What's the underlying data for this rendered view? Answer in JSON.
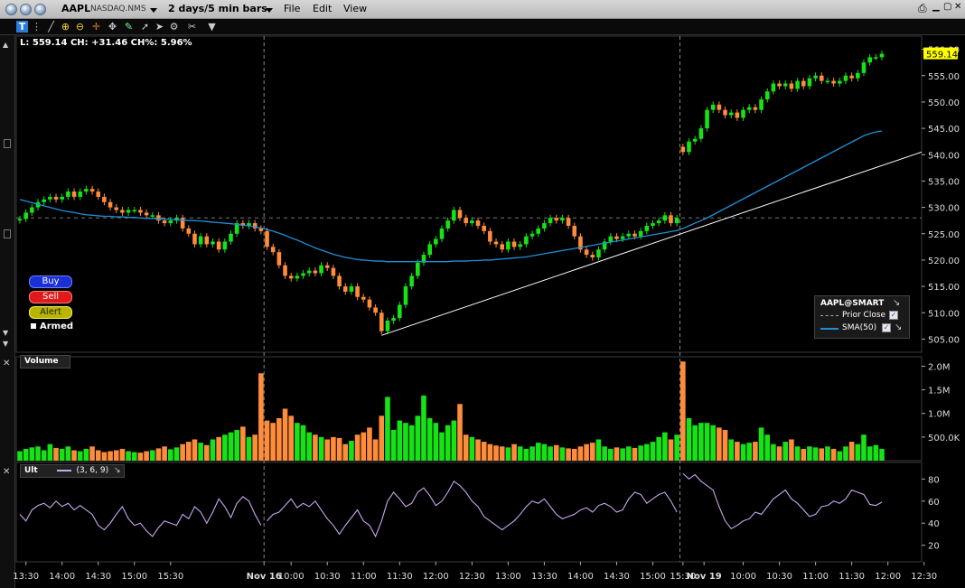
{
  "window": {
    "symbol": "AAPL",
    "exchange": "NASDAQ.NMS",
    "period": "2 days/5 min bars",
    "menus": [
      "File",
      "Edit",
      "View"
    ]
  },
  "quote": {
    "label": "L:",
    "last": "559.14",
    "change_label": "CH:",
    "change": "+31.46",
    "change_pct_label": "CH%:",
    "change_pct": "5.96%"
  },
  "order_buttons": {
    "buy": "Buy",
    "sell": "Sell",
    "alert": "Alert",
    "armed": "Armed"
  },
  "legend": {
    "title": "AAPL@SMART",
    "items": [
      {
        "label": "Prior Close",
        "color": "#aaaaaa",
        "style": "dashed"
      },
      {
        "label": "SMA(50)",
        "color": "#1e8fd6",
        "style": "solid"
      }
    ]
  },
  "volume_panel": {
    "title": "Volume"
  },
  "ult_panel": {
    "title": "Ult",
    "params": "(3, 6, 9)",
    "color": "#c9a8f0"
  },
  "colors": {
    "up": "#16e316",
    "down": "#ff8c3a",
    "sma": "#1e8fd6",
    "trendline": "#ffffff",
    "background": "#000000",
    "price_highlight": "#ffff00"
  },
  "chart_data": [
    {
      "type": "candlestick",
      "title": "AAPL",
      "last_price": 559.14,
      "prior_close": 528.0,
      "ylim": [
        502.5,
        562.5
      ],
      "y_ticks": [
        "505.00",
        "510.00",
        "515.00",
        "520.00",
        "525.00",
        "530.00",
        "535.00",
        "540.00",
        "545.00",
        "550.00",
        "555.00",
        "560.00"
      ],
      "x_ticks": [
        "13:30",
        "14:00",
        "14:30",
        "15:00",
        "15:30",
        "Nov 16",
        "10:00",
        "10:30",
        "11:00",
        "11:30",
        "12:00",
        "12:30",
        "13:00",
        "13:30",
        "14:00",
        "14:30",
        "15:00",
        "15:30",
        "Nov 19",
        "10:00",
        "10:30",
        "11:00",
        "11:30",
        "12:00",
        "12:30"
      ],
      "session_breaks": [
        "Nov 16",
        "Nov 19"
      ],
      "closes": [
        527.8,
        529.0,
        530.0,
        531.0,
        531.5,
        532.0,
        531.5,
        532.0,
        533.0,
        532.0,
        533.0,
        533.5,
        533.0,
        532.0,
        531.0,
        530.0,
        529.5,
        529.0,
        529.5,
        529.5,
        529.0,
        528.5,
        528.5,
        527.5,
        527.0,
        527.5,
        528.0,
        526.0,
        525.0,
        523.0,
        524.5,
        523.0,
        523.5,
        522.0,
        523.5,
        525.0,
        527.0,
        526.5,
        527.0,
        526.0,
        525.5,
        522.5,
        521.5,
        519.0,
        517.0,
        516.5,
        517.0,
        517.5,
        518.0,
        517.5,
        519.0,
        518.5,
        517.0,
        515.0,
        514.0,
        515.0,
        513.0,
        512.5,
        511.0,
        510.0,
        506.5,
        508.5,
        509.0,
        511.5,
        515.0,
        517.0,
        519.5,
        521.0,
        523.0,
        524.0,
        526.0,
        527.5,
        529.5,
        528.0,
        527.0,
        527.5,
        526.5,
        525.5,
        523.5,
        523.0,
        522.0,
        523.5,
        522.5,
        523.0,
        524.5,
        525.0,
        526.0,
        527.0,
        528.0,
        527.5,
        528.0,
        526.5,
        524.5,
        522.0,
        521.0,
        520.5,
        522.0,
        523.5,
        524.5,
        524.0,
        524.5,
        525.0,
        524.5,
        525.5,
        526.5,
        527.0,
        527.5,
        528.5,
        527.0,
        528.0,
        540.5,
        542.5,
        543.0,
        545.0,
        548.5,
        549.5,
        548.5,
        547.5,
        548.0,
        547.0,
        548.5,
        549.0,
        548.5,
        550.5,
        552.0,
        553.5,
        553.0,
        553.5,
        552.5,
        554.0,
        553.0,
        554.5,
        555.0,
        554.0,
        554.0,
        553.5,
        554.0,
        555.0,
        554.5,
        555.5,
        557.5,
        558.5,
        558.5,
        559.14
      ],
      "sma_50": [
        531.5,
        531.2,
        530.9,
        530.6,
        530.3,
        530.0,
        529.7,
        529.4,
        529.2,
        529.0,
        528.8,
        528.6,
        528.5,
        528.4,
        528.3,
        528.3,
        528.2,
        528.2,
        528.1,
        528.1,
        528.0,
        527.9,
        527.9,
        527.8,
        527.8,
        527.7,
        527.6,
        527.6,
        527.5,
        527.5,
        527.4,
        527.3,
        527.2,
        527.1,
        527.0,
        526.9,
        526.8,
        526.6,
        526.5,
        526.3,
        526.1,
        525.8,
        525.5,
        525.1,
        524.7,
        524.2,
        523.8,
        523.3,
        522.8,
        522.3,
        521.9,
        521.5,
        521.1,
        520.8,
        520.5,
        520.3,
        520.1,
        520.0,
        519.9,
        519.8,
        519.8,
        519.7,
        519.7,
        519.7,
        519.7,
        519.7,
        519.7,
        519.7,
        519.7,
        519.7,
        519.7,
        519.7,
        519.8,
        519.8,
        519.8,
        519.9,
        519.9,
        520.0,
        520.0,
        520.1,
        520.2,
        520.3,
        520.4,
        520.5,
        520.6,
        520.8,
        521.0,
        521.2,
        521.4,
        521.6,
        521.8,
        522.0,
        522.2,
        522.4,
        522.6,
        522.8,
        523.0,
        523.2,
        523.4,
        523.6,
        523.8,
        524.0,
        524.2,
        524.4,
        524.6,
        524.8,
        525.0,
        525.2,
        525.4,
        525.6,
        526.0,
        526.5,
        527.0,
        527.5,
        528.0,
        528.6,
        529.2,
        529.8,
        530.4,
        531.0,
        531.6,
        532.2,
        532.8,
        533.4,
        534.0,
        534.6,
        535.2,
        535.8,
        536.4,
        537.0,
        537.6,
        538.2,
        538.8,
        539.4,
        540.0,
        540.6,
        541.2,
        541.8,
        542.4,
        543.0,
        543.6,
        544.0,
        544.3,
        544.5
      ],
      "trendline": {
        "from": {
          "bar": 60,
          "price": 505.7
        },
        "to": {
          "bar": 160,
          "price": 540.5
        }
      },
      "volume": {
        "y_ticks": [
          "500.0K",
          "1.0M",
          "1.5M",
          "2.0M"
        ],
        "ylim": [
          0,
          2.2
        ],
        "values_m": [
          0.2,
          0.25,
          0.28,
          0.3,
          0.22,
          0.35,
          0.27,
          0.25,
          0.3,
          0.22,
          0.2,
          0.25,
          0.3,
          0.22,
          0.18,
          0.2,
          0.22,
          0.25,
          0.2,
          0.18,
          0.17,
          0.2,
          0.22,
          0.26,
          0.3,
          0.24,
          0.28,
          0.35,
          0.4,
          0.45,
          0.38,
          0.33,
          0.45,
          0.5,
          0.55,
          0.6,
          0.65,
          0.72,
          0.5,
          0.55,
          1.85,
          0.85,
          0.8,
          0.9,
          1.1,
          0.95,
          0.8,
          0.75,
          0.6,
          0.55,
          0.5,
          0.45,
          0.5,
          0.48,
          0.35,
          0.42,
          0.55,
          0.6,
          0.7,
          0.45,
          0.95,
          1.35,
          0.65,
          0.85,
          0.8,
          0.75,
          0.95,
          1.38,
          0.9,
          0.8,
          0.6,
          0.75,
          0.85,
          1.2,
          0.55,
          0.5,
          0.45,
          0.4,
          0.35,
          0.32,
          0.3,
          0.28,
          0.35,
          0.3,
          0.25,
          0.3,
          0.38,
          0.35,
          0.3,
          0.33,
          0.28,
          0.26,
          0.25,
          0.3,
          0.35,
          0.38,
          0.45,
          0.3,
          0.25,
          0.28,
          0.26,
          0.3,
          0.27,
          0.32,
          0.35,
          0.4,
          0.5,
          0.6,
          0.45,
          0.55,
          2.1,
          0.9,
          0.75,
          0.8,
          0.8,
          0.75,
          0.7,
          0.65,
          0.45,
          0.4,
          0.35,
          0.38,
          0.4,
          0.7,
          0.55,
          0.35,
          0.3,
          0.4,
          0.45,
          0.3,
          0.25,
          0.3,
          0.28,
          0.26,
          0.3,
          0.25,
          0.2,
          0.3,
          0.4,
          0.35,
          0.55,
          0.3,
          0.33,
          0.25
        ]
      },
      "ult_oscillator": {
        "y_ticks": [
          "20",
          "40",
          "60",
          "80"
        ],
        "ylim": [
          5,
          95
        ],
        "values": [
          48,
          42,
          52,
          56,
          58,
          54,
          60,
          55,
          58,
          52,
          56,
          52,
          48,
          38,
          34,
          40,
          48,
          55,
          44,
          38,
          40,
          33,
          28,
          36,
          42,
          40,
          38,
          48,
          44,
          55,
          50,
          40,
          50,
          62,
          55,
          45,
          58,
          64,
          60,
          48,
          38,
          42,
          48,
          50,
          56,
          62,
          54,
          58,
          55,
          60,
          52,
          44,
          38,
          30,
          38,
          45,
          52,
          42,
          38,
          28,
          42,
          60,
          68,
          62,
          55,
          58,
          68,
          72,
          65,
          56,
          60,
          68,
          78,
          74,
          68,
          60,
          55,
          46,
          42,
          38,
          34,
          38,
          42,
          48,
          55,
          60,
          58,
          62,
          55,
          48,
          44,
          46,
          48,
          52,
          54,
          50,
          56,
          58,
          55,
          50,
          52,
          62,
          68,
          66,
          58,
          62,
          66,
          68,
          60,
          50,
          85,
          80,
          84,
          78,
          74,
          70,
          55,
          42,
          35,
          38,
          42,
          44,
          50,
          48,
          55,
          62,
          66,
          70,
          62,
          58,
          52,
          46,
          48,
          55,
          56,
          60,
          58,
          62,
          70,
          68,
          66,
          57,
          56,
          59
        ]
      }
    }
  ]
}
